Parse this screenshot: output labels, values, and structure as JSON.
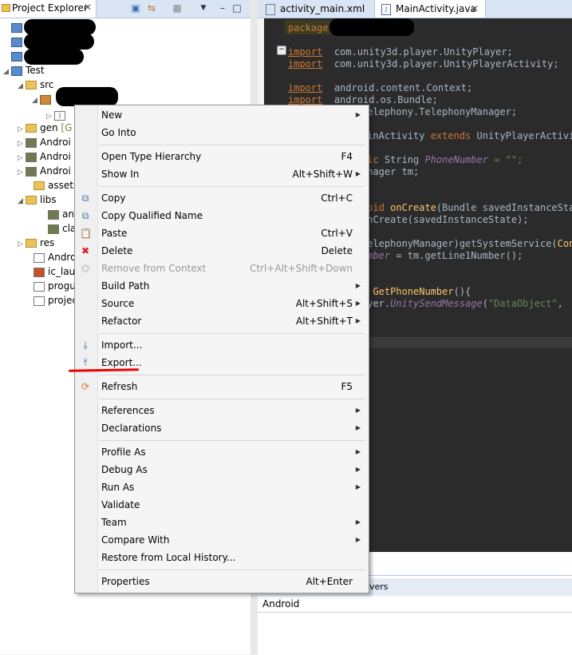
{
  "left_panel": {
    "tab_label": "Project Explorer",
    "close_glyph": "✕",
    "tree": [
      {
        "label": "",
        "icon": "project-icon",
        "redacted": true
      },
      {
        "label": "",
        "icon": "project-icon",
        "redacted": true
      },
      {
        "label": "",
        "icon": "project-icon",
        "redacted": true
      },
      {
        "label": "Test",
        "icon": "project-icon"
      },
      {
        "label": "src",
        "icon": "folder-icon"
      },
      {
        "label": "",
        "icon": "package-icon",
        "redacted": true
      },
      {
        "label": "J",
        "icon": "java-file-icon"
      },
      {
        "label": "gen [G",
        "icon": "folder-icon"
      },
      {
        "label": "Androi",
        "icon": "jar-icon"
      },
      {
        "label": "Androi",
        "icon": "jar-icon"
      },
      {
        "label": "Androi",
        "icon": "jar-icon"
      },
      {
        "label": "assets",
        "icon": "folder-icon"
      },
      {
        "label": "libs",
        "icon": "folder-icon"
      },
      {
        "label": "anc",
        "icon": "jar-icon"
      },
      {
        "label": "clas",
        "icon": "jar-icon"
      },
      {
        "label": "res",
        "icon": "folder-icon"
      },
      {
        "label": "Androi",
        "icon": "file-icon"
      },
      {
        "label": "ic_laun",
        "icon": "image-file-icon"
      },
      {
        "label": "progua",
        "icon": "file-icon"
      },
      {
        "label": "project",
        "icon": "file-icon"
      }
    ]
  },
  "editor": {
    "tabs": [
      {
        "label": "activity_main.xml"
      },
      {
        "label": "MainActivity.java",
        "close": "✕"
      }
    ],
    "code": {
      "l1": "package",
      "l2": "import com.unity3d.player.UnityPlayer;",
      "l3": "import com.unity3d.player.UnityPlayerActivity;",
      "l4": "import android.content.Context;",
      "l5": "import android.os.Bundle;",
      "l6": "telephony.TelephonyManager;",
      "l7a": "ainActivity",
      "l7b": "extends",
      "l7c": "UnityPlayerActivi",
      "l8a": "tic String",
      "l8b": "PhoneNumber",
      "l8c": " = \"\";",
      "l9": "anager tm;",
      "l10a": "void",
      "l10b": "onCreate",
      "l10c": "(Bundle savedInstanceSta",
      "l11": "onCreate(savedInstanceState);",
      "l12a": "TelephonyManager)getSystemService(",
      "l12b": "Con",
      "l13a": "umber",
      "l13b": " = tm.getLine1Number();",
      "l14a": "d",
      "l14b": "GetPhoneNumber",
      "l14c": "(){",
      "l15a": "ayer.",
      "l15b": "UnitySendMessage",
      "l15c": "(\"DataObject\","
    },
    "bottom_tab": "vers",
    "bottom_text": "Android"
  },
  "context_menu": {
    "items": [
      {
        "label": "New",
        "submenu": true
      },
      {
        "label": "Go Into"
      },
      {
        "sep": true
      },
      {
        "label": "Open Type Hierarchy",
        "shortcut": "F4"
      },
      {
        "label": "Show In",
        "shortcut": "Alt+Shift+W",
        "submenu": true
      },
      {
        "sep": true
      },
      {
        "label": "Copy",
        "shortcut": "Ctrl+C",
        "icon": "copy-icon"
      },
      {
        "label": "Copy Qualified Name",
        "icon": "copy-qualified-icon"
      },
      {
        "label": "Paste",
        "shortcut": "Ctrl+V",
        "icon": "paste-icon"
      },
      {
        "label": "Delete",
        "shortcut": "Delete",
        "icon": "delete-icon"
      },
      {
        "label": "Remove from Context",
        "shortcut": "Ctrl+Alt+Shift+Down",
        "icon": "remove-context-icon",
        "disabled": true
      },
      {
        "label": "Build Path",
        "submenu": true
      },
      {
        "label": "Source",
        "shortcut": "Alt+Shift+S",
        "submenu": true
      },
      {
        "label": "Refactor",
        "shortcut": "Alt+Shift+T",
        "submenu": true
      },
      {
        "sep": true
      },
      {
        "label": "Import...",
        "icon": "import-icon"
      },
      {
        "label": "Export...",
        "icon": "export-icon"
      },
      {
        "sep": true
      },
      {
        "label": "Refresh",
        "shortcut": "F5",
        "icon": "refresh-icon"
      },
      {
        "sep": true
      },
      {
        "label": "References",
        "submenu": true
      },
      {
        "label": "Declarations",
        "submenu": true
      },
      {
        "sep": true
      },
      {
        "label": "Profile As",
        "submenu": true
      },
      {
        "label": "Debug As",
        "submenu": true
      },
      {
        "label": "Run As",
        "submenu": true
      },
      {
        "label": "Validate"
      },
      {
        "label": "Team",
        "submenu": true
      },
      {
        "label": "Compare With",
        "submenu": true
      },
      {
        "label": "Restore from Local History..."
      },
      {
        "sep": true
      },
      {
        "label": "Properties",
        "shortcut": "Alt+Enter"
      }
    ]
  },
  "colors": {
    "highlight_underline": "#ee0000",
    "editor_bg": "#2b2b2b"
  }
}
